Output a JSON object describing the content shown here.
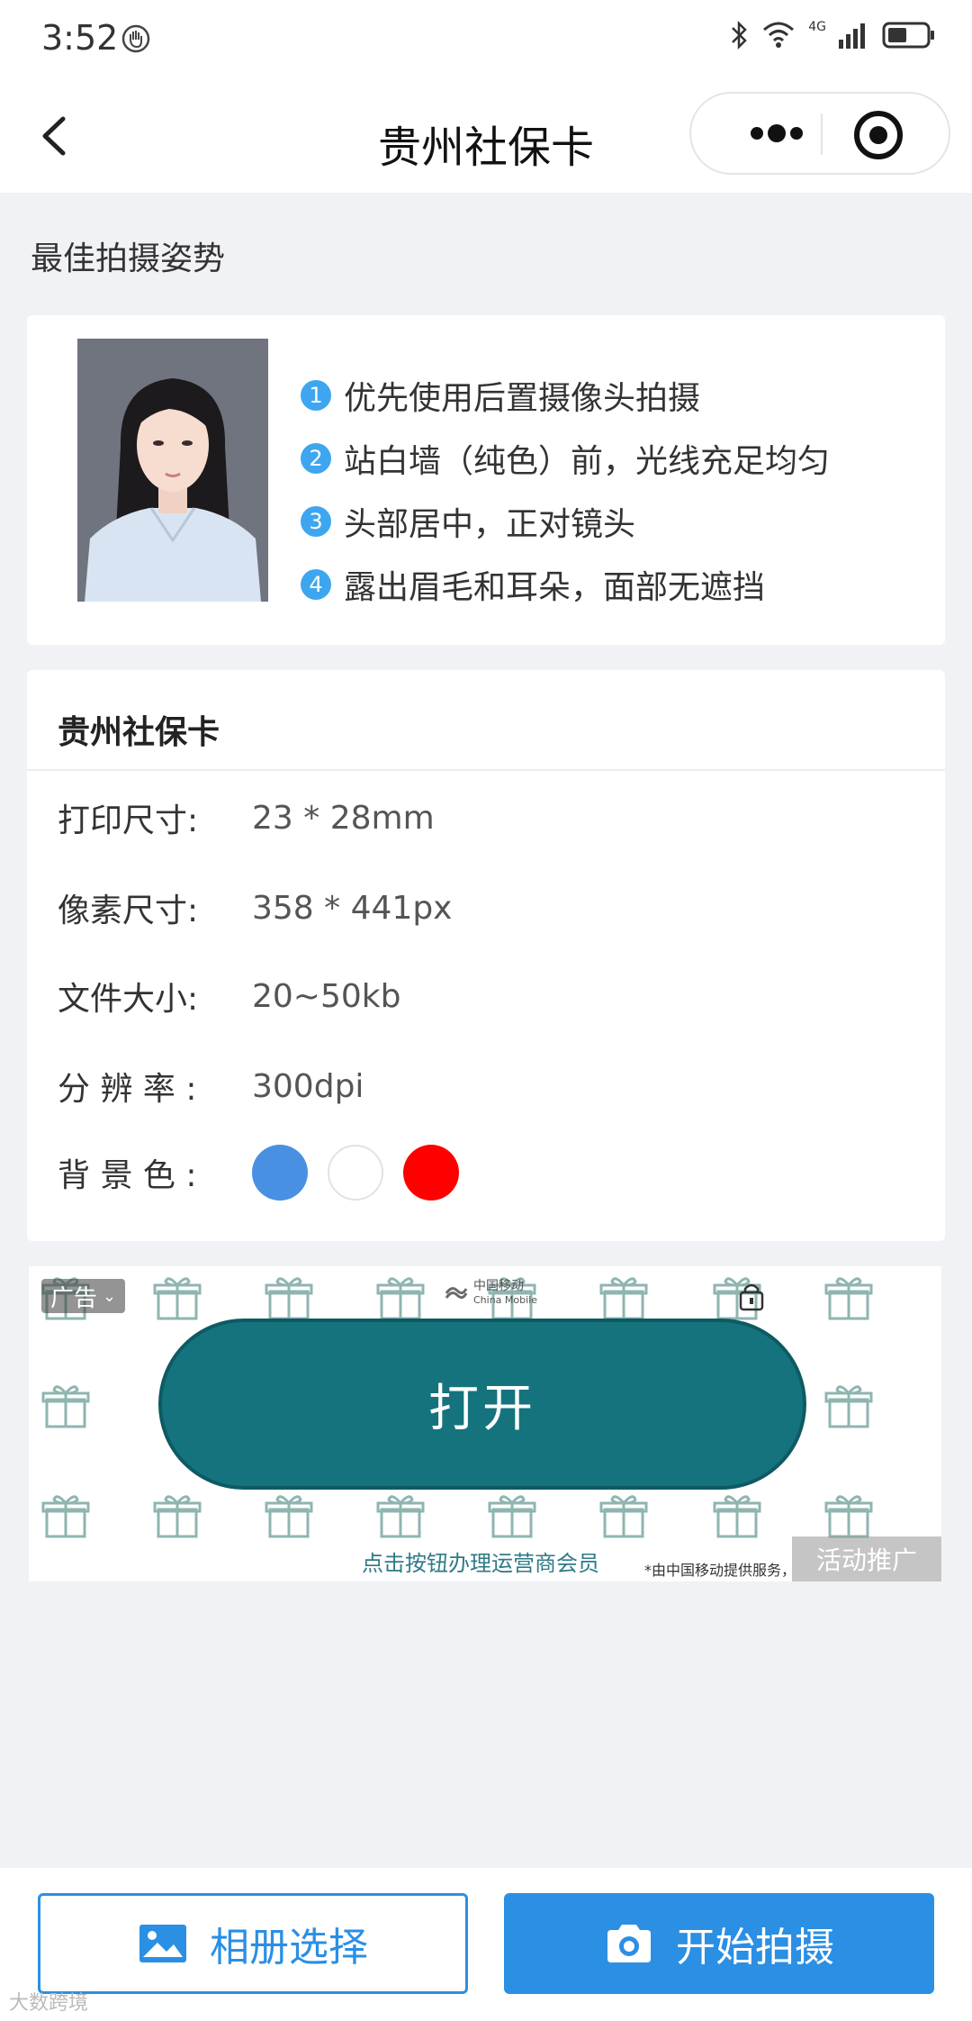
{
  "status_bar": {
    "time": "3:52",
    "network": "4G"
  },
  "nav": {
    "title": "贵州社保卡"
  },
  "posture": {
    "title": "最佳拍摄姿势",
    "tips": [
      {
        "num": "1",
        "text": "优先使用后置摄像头拍摄"
      },
      {
        "num": "2",
        "text": "站白墙（纯色）前，光线充足均匀"
      },
      {
        "num": "3",
        "text": "头部居中，正对镜头"
      },
      {
        "num": "4",
        "text": "露出眉毛和耳朵，面部无遮挡"
      }
    ]
  },
  "spec": {
    "title": "贵州社保卡",
    "print_size_label": "打印尺寸:",
    "print_size_value": "23 * 28mm",
    "pixel_size_label": "像素尺寸:",
    "pixel_size_value": "358 * 441px",
    "file_size_label": "文件大小:",
    "file_size_value": "20~50kb",
    "resolution_label": "分 辨 率 :",
    "resolution_value": "300dpi",
    "bg_color_label": "背 景 色 :",
    "bg_colors": [
      "#4a90e2",
      "#ffffff",
      "#ff0000"
    ]
  },
  "ad": {
    "tag": "广告",
    "brand_cn": "中国移动",
    "brand_en": "China Mobile",
    "button": "打开",
    "caption": "点击按钮办理运营商会员",
    "note": "*由中国移动提供服务，",
    "promo": "活动推广"
  },
  "bottom": {
    "album_label": "相册选择",
    "shoot_label": "开始拍摄"
  },
  "watermark": "大数跨境",
  "colors": {
    "accent": "#2b8fe4",
    "tip_badge": "#3ea6ef",
    "ad_button": "#15737e"
  }
}
